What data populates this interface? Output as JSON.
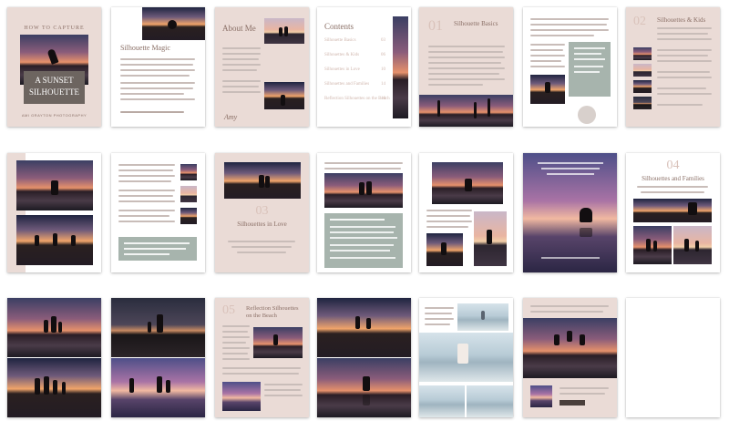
{
  "colors": {
    "blush": "#eadbd6",
    "sage": "#a7b4ad",
    "text": "#8a6f66"
  },
  "cover": {
    "line1": "HOW TO CAPTURE",
    "line2": "A SUNSET",
    "line3": "SILHOUETTE",
    "footer": "AMI GRAYTON PHOTOGRAPHY"
  },
  "p2": {
    "title": "Silhouette Magic"
  },
  "p3": {
    "title": "About Me",
    "signature": "Amy"
  },
  "p4": {
    "title": "Contents",
    "items": [
      "Silhouette Basics",
      "Silhouettes & Kids",
      "Silhouettes in Love",
      "Silhouettes and Families",
      "Reflection Silhouettes on the Beach"
    ],
    "pages": [
      "03",
      "06",
      "10",
      "14",
      "18"
    ]
  },
  "p5": {
    "number": "01",
    "title": "Silhouette Basics"
  },
  "p7": {
    "number": "02",
    "title": "Silhouettes & Kids"
  },
  "p10": {
    "number": "03",
    "title": "Silhouettes in Love"
  },
  "p14": {
    "number": "04",
    "title": "Silhouettes and Families"
  },
  "p17": {
    "number": "05",
    "title": "Reflection Silhouettes on the Beach"
  }
}
